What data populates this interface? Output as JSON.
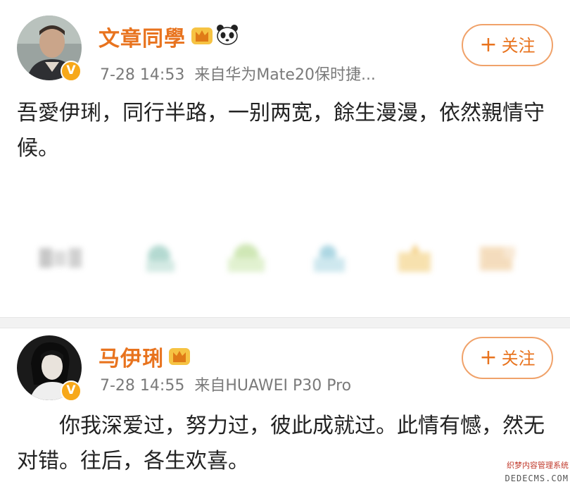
{
  "posts": [
    {
      "username": "文章同學",
      "time": "7-28 14:53",
      "source": "来自华为Mate20保时捷...",
      "follow_label": "关注",
      "text": "吾愛伊琍，同行半路，一别两宽，餘生漫漫，依然親情守候。",
      "avatar": "avatar-photo-man",
      "badges": [
        "crown-vip-icon",
        "panda-icon"
      ]
    },
    {
      "username": "马伊琍",
      "time": "7-28 14:55",
      "source": "来自HUAWEI P30 Pro",
      "follow_label": "关注",
      "text": "你我深爱过，努力过，彼此成就过。此情有憾，然无对错。往后，各生欢喜。",
      "avatar": "avatar-photo-woman",
      "badges": [
        "crown-vip-icon"
      ]
    }
  ],
  "verified_badge": "V",
  "watermark": {
    "line1": "织梦内容管理系统",
    "line2": "DEDECMS.COM"
  },
  "colors": {
    "accent": "#e8731e",
    "verified": "#f7a81a",
    "meta": "#7a7a7a",
    "separator": "#f2f2f2"
  }
}
